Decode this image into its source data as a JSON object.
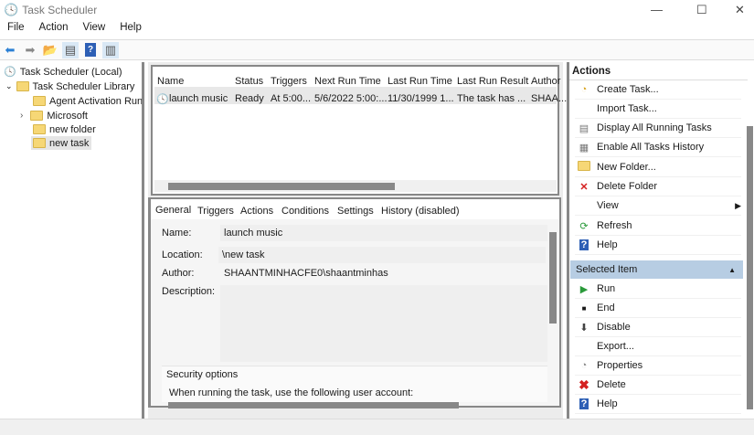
{
  "window": {
    "title": "Task Scheduler",
    "minimize": "—",
    "maximize": "☐",
    "close": "✕"
  },
  "menu": [
    "File",
    "Action",
    "View",
    "Help"
  ],
  "tree": {
    "root": "Task Scheduler (Local)",
    "library": "Task Scheduler Library",
    "children": [
      "Agent Activation Runt",
      "Microsoft",
      "new folder",
      "new task"
    ]
  },
  "list": {
    "columns": [
      "Name",
      "Status",
      "Triggers",
      "Next Run Time",
      "Last Run Time",
      "Last Run Result",
      "Author"
    ],
    "rows": [
      [
        "launch music",
        "Ready",
        "At 5:00...",
        "5/6/2022 5:00:...",
        "11/30/1999 1...",
        "The task has ...",
        "SHAA..."
      ]
    ]
  },
  "details": {
    "tabs": [
      "General",
      "Triggers",
      "Actions",
      "Conditions",
      "Settings",
      "History (disabled)"
    ],
    "name_label": "Name:",
    "name": "launch music",
    "location_label": "Location:",
    "location": "\\new task",
    "author_label": "Author:",
    "author": "SHAANTMINHACFE0\\shaantminhas",
    "description_label": "Description:",
    "security_title": "Security options",
    "security_text": "When running the task, use the following user account:"
  },
  "actions": {
    "title": "Actions",
    "items": [
      "Create Task...",
      "Import Task...",
      "Display All Running Tasks",
      "Enable All Tasks History",
      "New Folder...",
      "Delete Folder",
      "View",
      "Refresh",
      "Help"
    ],
    "selected_title": "Selected Item",
    "selected_items": [
      "Run",
      "End",
      "Disable",
      "Export...",
      "Properties",
      "Delete",
      "Help"
    ]
  }
}
